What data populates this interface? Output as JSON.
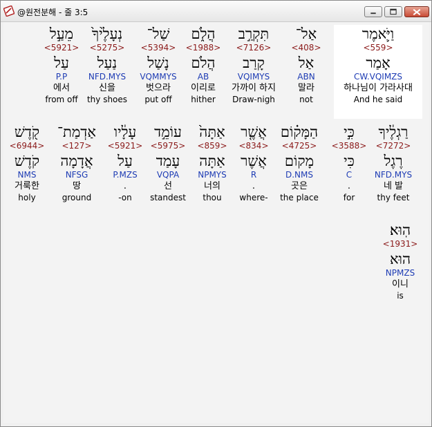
{
  "window": {
    "title": "@원전분해 - 줄 3:5"
  },
  "verse": {
    "row1": [
      {
        "hebrew": "וַיֹּ֛אמֶר",
        "strong": "<559>",
        "lemma": "אָמַר",
        "morph": "CW.VQIMZS",
        "korean": "하나님이 가라사대",
        "english": "And he said",
        "selected": true
      },
      {
        "hebrew": "אַל־",
        "strong": "<408>",
        "lemma": "אַל",
        "morph": "ABN",
        "korean": "말라",
        "english": "not"
      },
      {
        "hebrew": "תִּקְרַ֣ב",
        "strong": "<7126>",
        "lemma": "קָרַב",
        "morph": "VQIMYS",
        "korean": "가까이 하지",
        "english": "Draw-nigh"
      },
      {
        "hebrew": "הֲלֹ֑ם",
        "strong": "<1988>",
        "lemma": "הֲלֹם",
        "morph": "AB",
        "korean": "이리로",
        "english": "hither"
      },
      {
        "hebrew": "שַׁל־",
        "strong": "<5394>",
        "lemma": "נָשַׁל",
        "morph": "VQMMYS",
        "korean": "벗으라",
        "english": "put off"
      },
      {
        "hebrew": "נְעָלֶ֙יךָ֙",
        "strong": "<5275>",
        "lemma": "נַעַל",
        "morph": "NFD.MYS",
        "korean": "신을",
        "english": "thy shoes"
      },
      {
        "hebrew": "מֵעַ֣ל",
        "strong": "<5921>",
        "lemma": "עַל",
        "morph": "P.P",
        "korean": "에서",
        "english": "from off"
      }
    ],
    "row2": [
      {
        "hebrew": "רַגְלֶ֔יךָ",
        "strong": "<7272>",
        "lemma": "רֶגֶל",
        "morph": "NFD.MYS",
        "korean": "네 발",
        "english": "thy feet"
      },
      {
        "hebrew": "כִּ֣י",
        "strong": "<3588>",
        "lemma": "כִּי",
        "morph": "C",
        "korean": ".",
        "english": "for"
      },
      {
        "hebrew": "הַמָּק֗וֹם",
        "strong": "<4725>",
        "lemma": "מָקוֹם",
        "morph": "D.NMS",
        "korean": "곳은",
        "english": "the place"
      },
      {
        "hebrew": "אֲשֶׁ֤ר",
        "strong": "<834>",
        "lemma": "אֲשֶׁר",
        "morph": "R",
        "korean": ".",
        "english": "where-"
      },
      {
        "hebrew": "אַתָּה֙",
        "strong": "<859>",
        "lemma": "אַתָּה",
        "morph": "NPMYS",
        "korean": "너의",
        "english": "thou"
      },
      {
        "hebrew": "עוֹמֵ֣ד",
        "strong": "<5975>",
        "lemma": "עָמַד",
        "morph": "VQPA",
        "korean": "선",
        "english": "standest"
      },
      {
        "hebrew": "עָלָ֔יו",
        "strong": "<5921>",
        "lemma": "עַל",
        "morph": "P.MZS",
        "korean": ".",
        "english": "-on"
      },
      {
        "hebrew": "אַדְמַת־",
        "strong": "<127>",
        "lemma": "אֲדָמָה",
        "morph": "NFSG",
        "korean": "땅",
        "english": "ground"
      },
      {
        "hebrew": "קֹ֖דֶשׁ",
        "strong": "<6944>",
        "lemma": "קֹדֶשׁ",
        "morph": "NMS",
        "korean": "거룩한",
        "english": "holy"
      }
    ],
    "row3": [
      {
        "hebrew": "הֽוּא׃",
        "strong": "<1931>",
        "lemma": "הוּא",
        "morph": "NPMZS",
        "korean": "이니",
        "english": "is"
      }
    ]
  }
}
